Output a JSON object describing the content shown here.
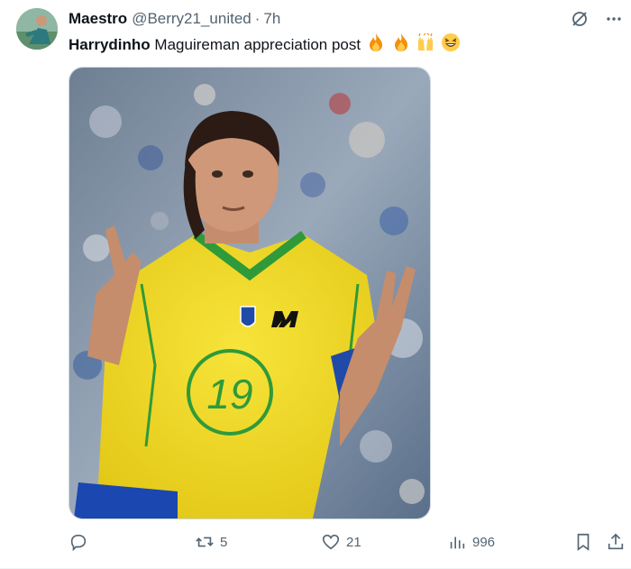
{
  "tweet": {
    "author_name": "Maestro",
    "handle": "@Berry21_united",
    "separator": "·",
    "time": "7h",
    "mention": "Harrydinho",
    "text": "Maguireman appreciation post",
    "emojis": [
      "fire-emoji",
      "fire-emoji",
      "raising-hands-emoji",
      "grinning-squinting-emoji"
    ],
    "media_alt": "Footballer in yellow number 19 jersey gesturing with both hands"
  },
  "metrics": {
    "replies": "",
    "retweets": "5",
    "likes": "21",
    "views": "996"
  },
  "colors": {
    "text_primary": "#0f1419",
    "text_secondary": "#536471",
    "jersey_yellow": "#f2dc2a",
    "jersey_green": "#2f9a3a",
    "shorts_blue": "#1b47b0"
  }
}
